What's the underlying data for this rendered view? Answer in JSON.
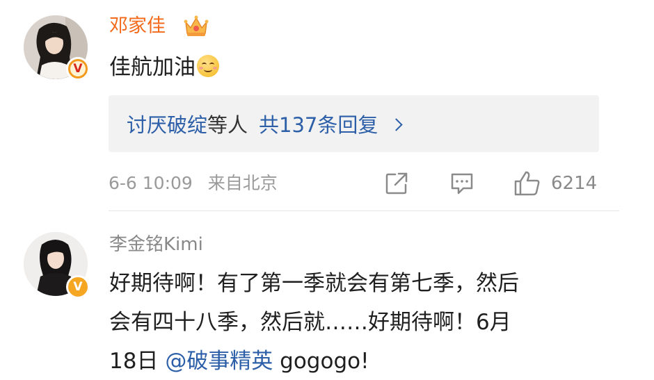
{
  "comments": [
    {
      "username": "邓家佳",
      "verified": "red-v",
      "vip_icon": "crown-icon",
      "text": "佳航加油",
      "emoji": "smile-emoji",
      "reply": {
        "names": "讨厌破绽",
        "middle": "等人",
        "total": "共137条回复"
      },
      "date": "6-6 10:09",
      "location": "来自北京",
      "likes": "6214",
      "accent_color": "#f36a1b"
    },
    {
      "username": "李金铭Kimi",
      "verified": "gold-v",
      "text_line1": "好期待啊！有了第一季就会有第七季，然后",
      "text_line2": "会有四十八季，然后就……好期待啊！6月",
      "text_line3_prefix": "18日 ",
      "mention": "@破事精英",
      "text_line3_suffix": " gogogo!",
      "link_color": "#2c5fa8"
    }
  ],
  "icons": {
    "share": "share-icon",
    "comment": "comment-icon",
    "like": "thumbs-up-icon",
    "chevron": "chevron-right-icon",
    "verified_badge": "v-badge-icon"
  }
}
